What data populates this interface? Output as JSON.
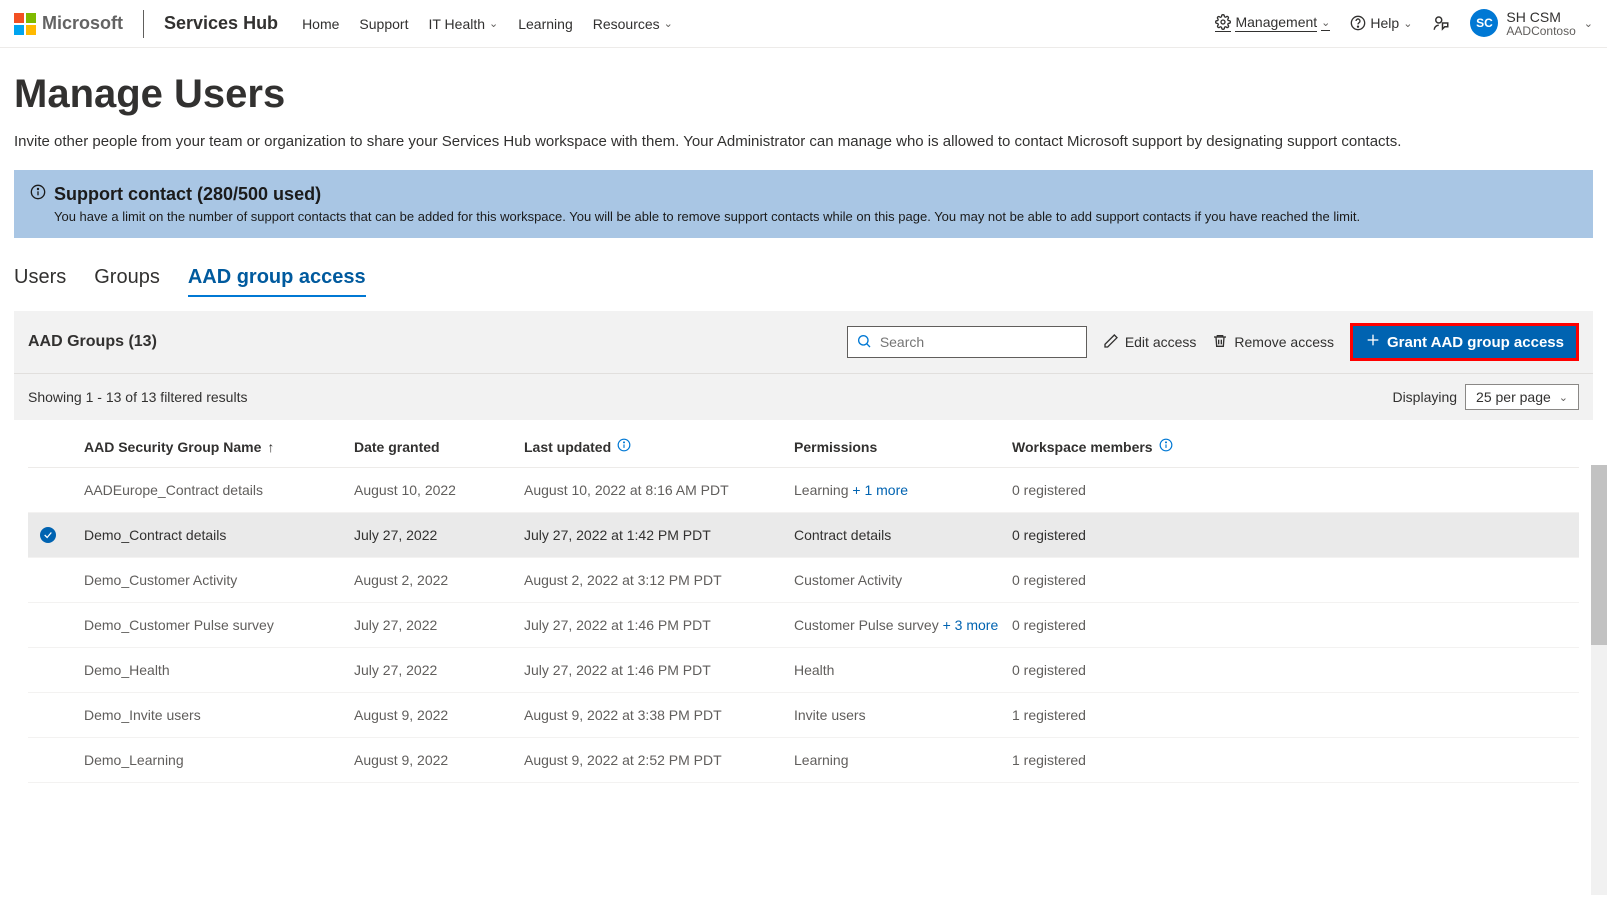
{
  "header": {
    "ms_word": "Microsoft",
    "brand": "Services Hub",
    "nav": [
      "Home",
      "Support",
      "IT Health",
      "Learning",
      "Resources"
    ],
    "management": "Management",
    "help": "Help",
    "account": {
      "initials": "SC",
      "name": "SH CSM",
      "org": "AADContoso"
    }
  },
  "page": {
    "title": "Manage Users",
    "subtitle": "Invite other people from your team or organization to share your Services Hub workspace with them. Your Administrator can manage who is allowed to contact Microsoft support by designating support contacts."
  },
  "banner": {
    "title": "Support contact (280/500 used)",
    "body": "You have a limit on the number of support contacts that can be added for this workspace. You will be able to remove support contacts while on this page. You may not be able to add support contacts if you have reached the limit."
  },
  "tabs": {
    "items": [
      "Users",
      "Groups",
      "AAD group access"
    ],
    "active": 2
  },
  "toolbar": {
    "title": "AAD Groups (13)",
    "search_placeholder": "Search",
    "edit": "Edit access",
    "remove": "Remove access",
    "grant": "Grant AAD group access"
  },
  "results": {
    "showing": "Showing 1 - 13 of 13 filtered results",
    "displaying": "Displaying",
    "per_page": "25 per page"
  },
  "columns": {
    "name": "AAD Security Group Name",
    "date": "Date granted",
    "updated": "Last updated",
    "perm": "Permissions",
    "members": "Workspace members"
  },
  "rows": [
    {
      "selected": false,
      "name": "AADEurope_Contract details",
      "date": "August 10, 2022",
      "updated": "August 10, 2022 at 8:16 AM PDT",
      "perm": "Learning",
      "perm_more": " + 1 more",
      "members": "0 registered"
    },
    {
      "selected": true,
      "name": "Demo_Contract details",
      "date": "July 27, 2022",
      "updated": "July 27, 2022 at 1:42 PM PDT",
      "perm": "Contract details",
      "perm_more": "",
      "members": "0 registered"
    },
    {
      "selected": false,
      "name": "Demo_Customer Activity",
      "date": "August 2, 2022",
      "updated": "August 2, 2022 at 3:12 PM PDT",
      "perm": "Customer Activity",
      "perm_more": "",
      "members": "0 registered"
    },
    {
      "selected": false,
      "name": "Demo_Customer Pulse survey",
      "date": "July 27, 2022",
      "updated": "July 27, 2022 at 1:46 PM PDT",
      "perm": "Customer Pulse survey",
      "perm_more": " + 3 more",
      "members": "0 registered"
    },
    {
      "selected": false,
      "name": "Demo_Health",
      "date": "July 27, 2022",
      "updated": "July 27, 2022 at 1:46 PM PDT",
      "perm": "Health",
      "perm_more": "",
      "members": "0 registered"
    },
    {
      "selected": false,
      "name": "Demo_Invite users",
      "date": "August 9, 2022",
      "updated": "August 9, 2022 at 3:38 PM PDT",
      "perm": "Invite users",
      "perm_more": "",
      "members": "1 registered"
    },
    {
      "selected": false,
      "name": "Demo_Learning",
      "date": "August 9, 2022",
      "updated": "August 9, 2022 at 2:52 PM PDT",
      "perm": "Learning",
      "perm_more": "",
      "members": "1 registered"
    }
  ]
}
